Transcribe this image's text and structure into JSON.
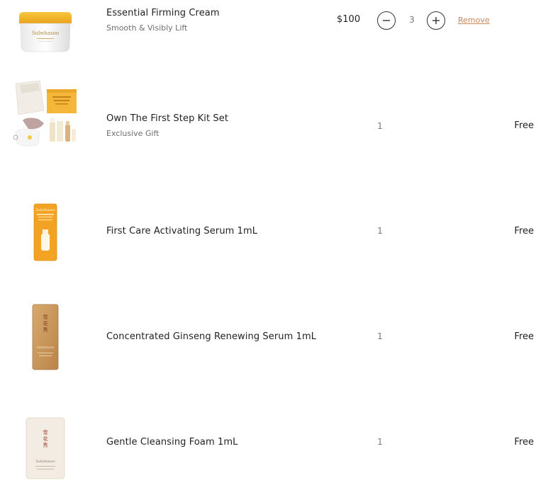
{
  "items": [
    {
      "name": "Essential Firming Cream",
      "subtitle": "Smooth & Visibly Lift",
      "price": "$100",
      "quantity": "3",
      "remove_label": "Remove",
      "thumb": "firming-cream-jar"
    },
    {
      "name": "Own The First Step Kit Set",
      "subtitle": "Exclusive Gift",
      "quantity": "1",
      "price": "Free",
      "thumb": "gift-kit-set"
    },
    {
      "name": "First Care Activating Serum 1mL",
      "quantity": "1",
      "price": "Free",
      "thumb": "serum-sachet-orange"
    },
    {
      "name": "Concentrated Ginseng Renewing Serum 1mL",
      "quantity": "1",
      "price": "Free",
      "thumb": "ginseng-sachet-gold"
    },
    {
      "name": "Gentle Cleansing Foam 1mL",
      "quantity": "1",
      "price": "Free",
      "thumb": "cleansing-foam-sachet"
    }
  ],
  "icons": {
    "decrease": "minus-icon",
    "increase": "plus-icon"
  },
  "colors": {
    "remove_link": "#c6875a",
    "sachet_orange": "#f2a324",
    "sachet_gold": "#c9955c",
    "cream_lid": "#f3b628"
  }
}
